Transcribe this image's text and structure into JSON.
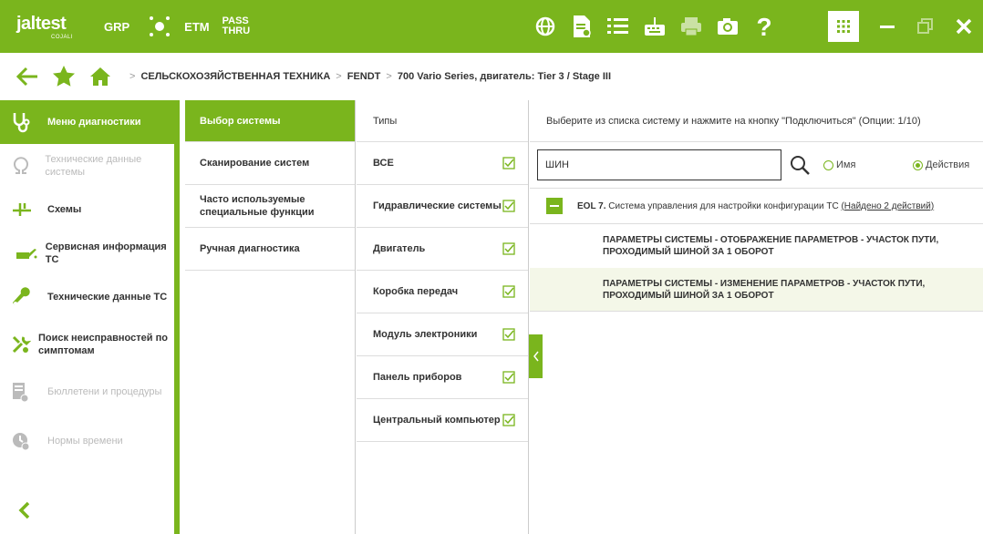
{
  "topbar": {
    "logo_text": "jaltest",
    "logo_sub": "COJALI",
    "grp": "GRP",
    "etm": "ETM",
    "pass_line1": "PASS",
    "pass_line2": "THRU",
    "icons": [
      "globe-icon",
      "document-icon",
      "list-icon",
      "keyboard-icon",
      "printer-icon",
      "camera-icon",
      "help-icon"
    ],
    "apps_icon": "grid-icon",
    "accent": "#7ab51d"
  },
  "nav": {
    "breadcrumbs": [
      "СЕЛЬСКОХОЗЯЙСТВЕННАЯ ТЕХНИКА",
      "FENDT",
      "700 Vario Series, двигатель: Tier 3 / Stage III"
    ]
  },
  "sidebar": {
    "items": [
      {
        "label": "Меню диагностики",
        "icon": "stethoscope-icon"
      },
      {
        "label": "Технические данные системы",
        "icon": "omega-icon"
      },
      {
        "label": "Схемы",
        "icon": "schematic-icon"
      },
      {
        "label": "Сервисная информация ТС",
        "icon": "oil-can-icon"
      },
      {
        "label": "Технические данные ТС",
        "icon": "wrench-icon"
      },
      {
        "label": "Поиск неисправностей по симптомам",
        "icon": "tools-icon"
      },
      {
        "label": "Бюллетени и процедуры",
        "icon": "bulletin-icon"
      },
      {
        "label": "Нормы времени",
        "icon": "timer-icon"
      }
    ]
  },
  "systems": {
    "items": [
      "Выбор системы",
      "Сканирование систем",
      "Часто используемые специальные функции",
      "Ручная диагностика"
    ]
  },
  "types": {
    "header": "Типы",
    "items": [
      "ВСЕ",
      "Гидравлические системы",
      "Двигатель",
      "Коробка передач",
      "Модуль электроники",
      "Панель приборов",
      "Центральный компьютер"
    ]
  },
  "main": {
    "instruction": "Выберите из списка систему и нажмите на кнопку \"Подключиться\" (Опции: 1/10)",
    "search_value": "ШИН",
    "radio_name": "Имя",
    "radio_actions": "Действия",
    "result": {
      "code": "EOL 7.",
      "text": "Система управления для настройки конфигурации ТС",
      "link": "(Найдено 2 действий)"
    },
    "actions": [
      "ПАРАМЕТРЫ СИСТЕМЫ - ОТОБРАЖЕНИЕ ПАРАМЕТРОВ - УЧАСТОК ПУТИ, ПРОХОДИМЫЙ ШИНОЙ ЗА 1 ОБОРОТ",
      "ПАРАМЕТРЫ СИСТЕМЫ - ИЗМЕНЕНИЕ ПАРАМЕТРОВ - УЧАСТОК ПУТИ, ПРОХОДИМЫЙ ШИНОЙ ЗА 1 ОБОРОТ"
    ]
  }
}
